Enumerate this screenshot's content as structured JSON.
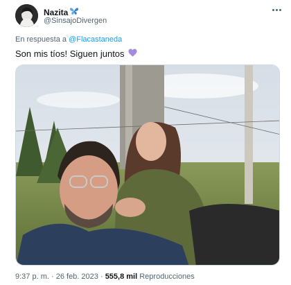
{
  "author": {
    "display_name": "Nazita",
    "name_emoji": "🦋",
    "handle": "@SinsajoDivergen",
    "avatar_icon": "profile-photo"
  },
  "reply": {
    "prefix": "En respuesta a",
    "mention": "@Flacastaneda"
  },
  "tweet": {
    "text": "Son mis tíos! Siguen juntos",
    "emoji": "💜"
  },
  "meta": {
    "time": "9:37 p. m.",
    "separator": "·",
    "date": "26 feb. 2023",
    "views_count": "555,8 mil",
    "views_label": "Reproducciones"
  },
  "colors": {
    "link": "#1d9bf0",
    "secondary_text": "#536471",
    "primary_text": "#0f1419"
  }
}
